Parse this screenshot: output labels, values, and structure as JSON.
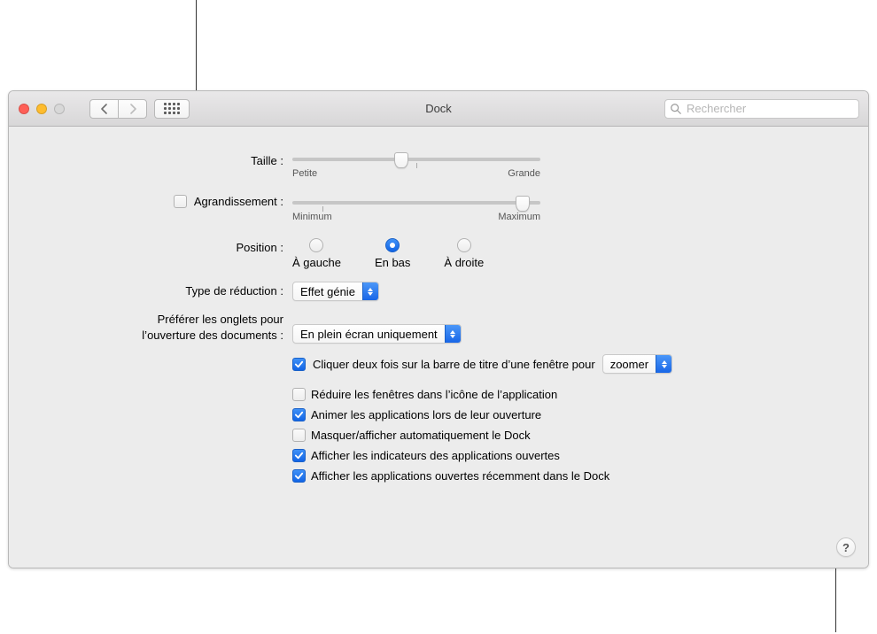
{
  "window": {
    "title": "Dock",
    "search_placeholder": "Rechercher"
  },
  "size": {
    "label": "Taille :",
    "min_label": "Petite",
    "max_label": "Grande",
    "value_percent": 44
  },
  "magnification": {
    "label": "Agrandissement :",
    "checked": false,
    "min_label": "Minimum",
    "max_label": "Maximum",
    "value_percent": 93
  },
  "position": {
    "label": "Position :",
    "options": [
      "À gauche",
      "En bas",
      "À droite"
    ],
    "selected_index": 1
  },
  "minimize_effect": {
    "label": "Type de réduction :",
    "value": "Effet génie"
  },
  "prefer_tabs": {
    "label_line1": "Préférer les onglets pour",
    "label_line2": "l’ouverture des documents :",
    "value": "En plein écran uniquement"
  },
  "double_click": {
    "label": "Cliquer deux fois sur la barre de titre d’une fenêtre pour",
    "checked": true,
    "action": "zoomer"
  },
  "checkboxes": [
    {
      "label": "Réduire les fenêtres dans l’icône de l’application",
      "checked": false
    },
    {
      "label": "Animer les applications lors de leur ouverture",
      "checked": true
    },
    {
      "label": "Masquer/afficher automatiquement le Dock",
      "checked": false
    },
    {
      "label": "Afficher les indicateurs des applications ouvertes",
      "checked": true
    },
    {
      "label": "Afficher les applications ouvertes récemment dans le Dock",
      "checked": true
    }
  ],
  "help_label": "?"
}
